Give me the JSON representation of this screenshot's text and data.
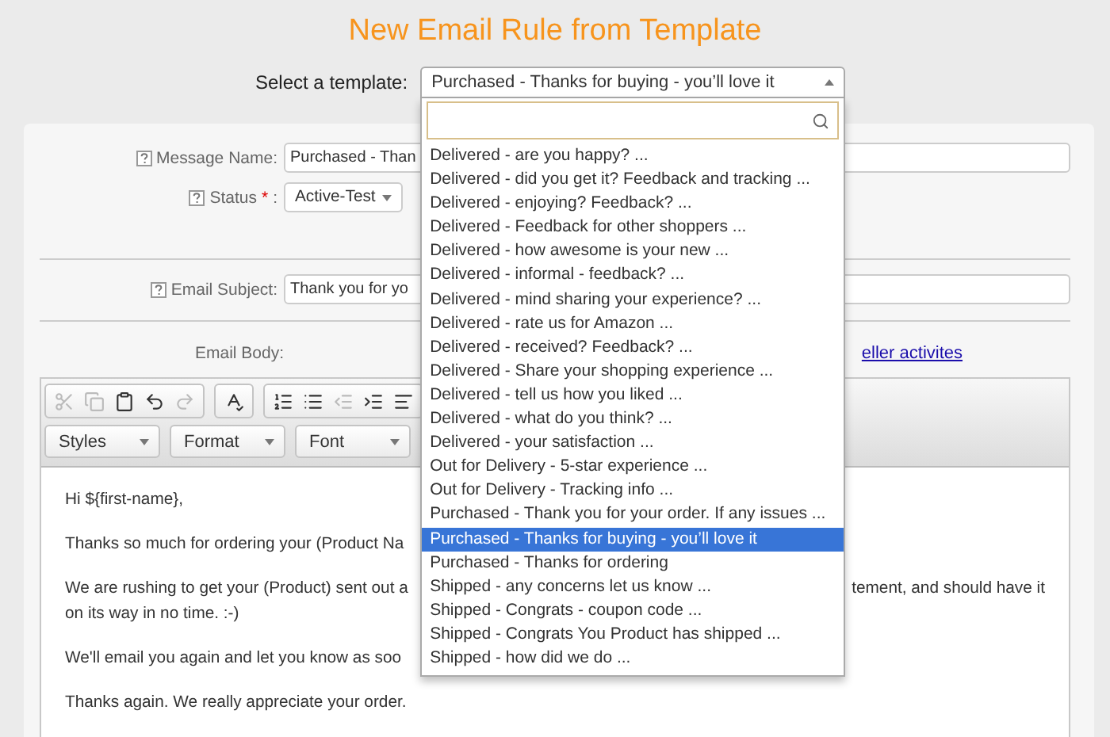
{
  "title": "New Email Rule from Template",
  "template_select": {
    "label": "Select a template:",
    "value": "Purchased - Thanks for buying - you’ll love it",
    "expanded": true,
    "options": [
      {
        "label": "Delivered - are you happy? ...",
        "selected": false
      },
      {
        "label": "Delivered - did you get it? Feedback and tracking ...",
        "selected": false
      },
      {
        "label": "Delivered - enjoying? Feedback? ...",
        "selected": false
      },
      {
        "label": "Delivered - Feedback for other shoppers ...",
        "selected": false
      },
      {
        "label": "Delivered - how awesome is your new ...",
        "selected": false
      },
      {
        "label": "Delivered - informal - feedback? ...",
        "selected": false
      },
      {
        "label": "Delivered - mind sharing your experience? ...",
        "selected": false
      },
      {
        "label": "Delivered - rate us for Amazon ...",
        "selected": false
      },
      {
        "label": "Delivered - received? Feedback? ...",
        "selected": false
      },
      {
        "label": "Delivered - Share your shopping experience ...",
        "selected": false
      },
      {
        "label": "Delivered - tell us how you liked ...",
        "selected": false
      },
      {
        "label": "Delivered - what do you think? ...",
        "selected": false
      },
      {
        "label": "Delivered - your satisfaction ...",
        "selected": false
      },
      {
        "label": "Out for Delivery - 5-star experience ...",
        "selected": false
      },
      {
        "label": "Out for Delivery - Tracking info ...",
        "selected": false
      },
      {
        "label": "Purchased - Thank you for your order. If any issues ...",
        "selected": false
      },
      {
        "label": "Purchased - Thanks for buying - you’ll love it",
        "selected": true
      },
      {
        "label": "Purchased - Thanks for ordering",
        "selected": false
      },
      {
        "label": "Shipped - any concerns let us know ...",
        "selected": false
      },
      {
        "label": "Shipped - Congrats - coupon code ...",
        "selected": false
      },
      {
        "label": "Shipped - Congrats You Product has shipped ...",
        "selected": false
      },
      {
        "label": "Shipped - how did we do ...",
        "selected": false
      }
    ]
  },
  "message_name": {
    "label": "Message Name:",
    "value": "Purchased - Than"
  },
  "status": {
    "label": "Status",
    "required_mark": "*",
    "label_end": ":",
    "value": "Active-Test"
  },
  "email_subject": {
    "label": "Email Subject:",
    "value": "Thank you for yo"
  },
  "email_body": {
    "label": "Email Body:",
    "link": "eller activites"
  },
  "editor": {
    "tools": [
      {
        "kind": "cut",
        "disabled": true
      },
      {
        "kind": "copy",
        "disabled": true
      },
      {
        "kind": "paste",
        "disabled": false
      },
      {
        "kind": "undo",
        "disabled": false
      },
      {
        "kind": "redo",
        "disabled": true
      },
      {
        "kind": "spellcheck",
        "disabled": false
      },
      {
        "kind": "numbered-list",
        "disabled": false
      },
      {
        "kind": "bulleted-list",
        "disabled": false
      },
      {
        "kind": "outdent",
        "disabled": true
      },
      {
        "kind": "indent",
        "disabled": false
      },
      {
        "kind": "align-left",
        "disabled": false
      }
    ],
    "menus": [
      "Styles",
      "Format",
      "Font"
    ],
    "paragraphs": [
      {
        "lines": [
          {
            "left": "Hi ${first-name},"
          }
        ]
      },
      {
        "lines": [
          {
            "left": "Thanks so much for ordering your (Product Na"
          }
        ]
      },
      {
        "lines": [
          {
            "left": "We are rushing to get your (Product) sent out a",
            "right": "tement, and should have it"
          },
          {
            "left": "on its way in no time. :-)"
          }
        ]
      },
      {
        "lines": [
          {
            "left": "We'll email you again and let you know as soo"
          }
        ]
      },
      {
        "lines": [
          {
            "left": "Thanks again. We really appreciate your order."
          }
        ]
      }
    ]
  }
}
